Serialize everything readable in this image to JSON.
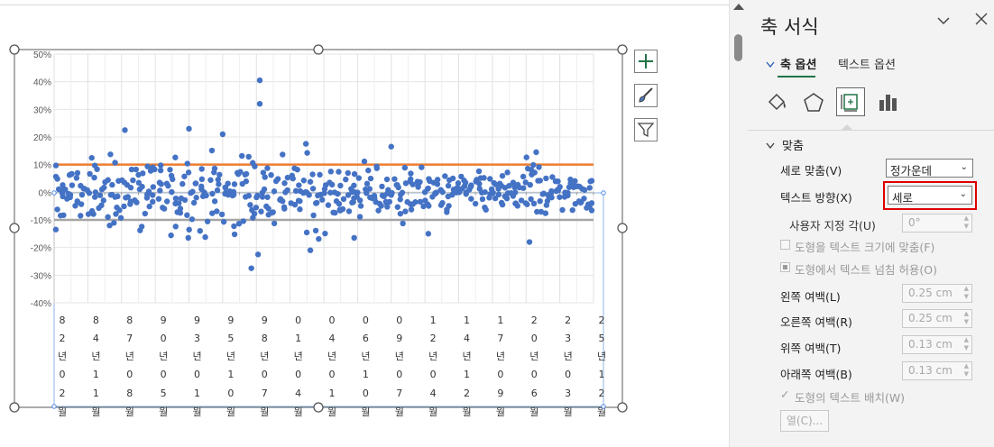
{
  "chart_data": {
    "type": "scatter",
    "title": "",
    "xlabel": "",
    "ylabel": "",
    "ylim": [
      -40,
      50
    ],
    "y_ticks": [
      "50%",
      "40%",
      "30%",
      "20%",
      "10%",
      "0%",
      "-10%",
      "-20%",
      "-30%",
      "-40%"
    ],
    "x_tick_labels": [
      [
        "8",
        "2",
        "년",
        "0",
        "2",
        "월"
      ],
      [
        "8",
        "4",
        "년",
        "1",
        "1",
        "월"
      ],
      [
        "8",
        "7",
        "년",
        "0",
        "8",
        "월"
      ],
      [
        "9",
        "0",
        "년",
        "0",
        "5",
        "월"
      ],
      [
        "9",
        "3",
        "년",
        "0",
        "1",
        "월"
      ],
      [
        "9",
        "5",
        "년",
        "1",
        "0",
        "월"
      ],
      [
        "9",
        "8",
        "년",
        "0",
        "7",
        "월"
      ],
      [
        "0",
        "1",
        "년",
        "0",
        "4",
        "월"
      ],
      [
        "0",
        "4",
        "년",
        "0",
        "1",
        "월"
      ],
      [
        "0",
        "6",
        "년",
        "1",
        "0",
        "월"
      ],
      [
        "0",
        "9",
        "년",
        "0",
        "7",
        "월"
      ],
      [
        "1",
        "2",
        "년",
        "0",
        "4",
        "월"
      ],
      [
        "1",
        "4",
        "년",
        "1",
        "2",
        "월"
      ],
      [
        "1",
        "7",
        "년",
        "0",
        "9",
        "월"
      ],
      [
        "2",
        "0",
        "년",
        "0",
        "6",
        "월"
      ],
      [
        "2",
        "3",
        "년",
        "0",
        "3",
        "월"
      ],
      [
        "2",
        "5",
        "년",
        "1",
        "2",
        "월"
      ]
    ],
    "grid": true,
    "legend": "none",
    "reference_lines": [
      {
        "value": 10,
        "color": "#ed7d31"
      },
      {
        "value": -10,
        "color": "#a5a5a5"
      }
    ],
    "series_color": "#4472c4",
    "notable_points": [
      {
        "x_index": 0.05,
        "y": -13.5
      },
      {
        "x_index": 2.1,
        "y": 22.5
      },
      {
        "x_index": 4.0,
        "y": 23
      },
      {
        "x_index": 5.0,
        "y": 21
      },
      {
        "x_index": 5.85,
        "y": -27.5
      },
      {
        "x_index": 6.05,
        "y": -22.5
      },
      {
        "x_index": 6.1,
        "y": 40.5
      },
      {
        "x_index": 6.1,
        "y": 32
      },
      {
        "x_index": 7.6,
        "y": -21
      },
      {
        "x_index": 8.9,
        "y": -16.5
      },
      {
        "x_index": 10.0,
        "y": 16.5
      },
      {
        "x_index": 11.1,
        "y": -15
      },
      {
        "x_index": 14.1,
        "y": -18
      },
      {
        "x_index": 14.3,
        "y": 14.5
      }
    ]
  },
  "panel": {
    "title": "축 서식",
    "tabs": {
      "axis_options": "축 옵션",
      "text_options": "텍스트 옵션"
    },
    "section": "맞춤",
    "vertical_alignment": {
      "label": "세로 맞춤(V)",
      "value": "정가운데"
    },
    "text_direction": {
      "label": "텍스트 방향(X)",
      "value": "세로"
    },
    "custom_angle": {
      "label": "사용자 지정 각(U)",
      "value": "0°"
    },
    "resize_shape": "도형을 텍스트 크기에 맞춤(F)",
    "allow_overflow": "도형에서 텍스트 넘침 허용(O)",
    "left_margin": {
      "label": "왼쪽 여백(L)",
      "value": "0.25 cm"
    },
    "right_margin": {
      "label": "오른쪽 여백(R)",
      "value": "0.25 cm"
    },
    "top_margin": {
      "label": "위쪽 여백(T)",
      "value": "0.13 cm"
    },
    "bottom_margin": {
      "label": "아래쪽 여백(B)",
      "value": "0.13 cm"
    },
    "wrap_text": "도형의 텍스트 배치(W)",
    "columns_button": "열(C)..."
  },
  "icons": {
    "collapse": "chevron-down-icon",
    "close": "close-icon",
    "fill": "paint-bucket-icon",
    "effects": "pentagon-icon",
    "size": "size-properties-icon",
    "axis": "bar-chart-icon",
    "chart_elements": "plus-icon",
    "chart_styles": "brush-icon",
    "chart_filters": "filter-icon"
  }
}
